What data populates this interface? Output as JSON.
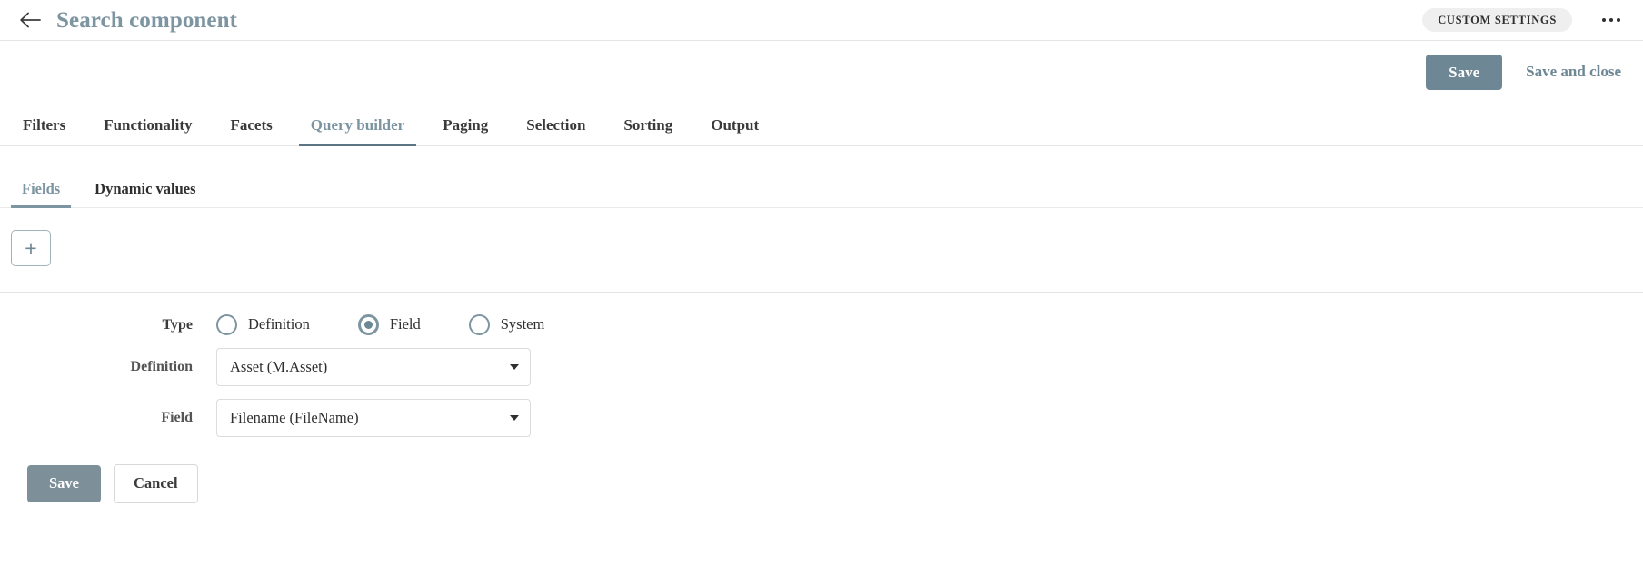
{
  "header": {
    "back_icon": "arrow-left-icon",
    "title": "Search component",
    "custom_settings_label": "CUSTOM SETTINGS",
    "overflow_icon": "ellipsis-icon"
  },
  "actions": {
    "save_label": "Save",
    "save_and_close_label": "Save and close"
  },
  "tabs": [
    {
      "label": "Filters",
      "active": false
    },
    {
      "label": "Functionality",
      "active": false
    },
    {
      "label": "Facets",
      "active": false
    },
    {
      "label": "Query builder",
      "active": true
    },
    {
      "label": "Paging",
      "active": false
    },
    {
      "label": "Selection",
      "active": false
    },
    {
      "label": "Sorting",
      "active": false
    },
    {
      "label": "Output",
      "active": false
    }
  ],
  "subtabs": [
    {
      "label": "Fields",
      "active": true
    },
    {
      "label": "Dynamic values",
      "active": false
    }
  ],
  "toolbar": {
    "add_label": "+"
  },
  "form": {
    "type": {
      "label": "Type",
      "options": [
        {
          "label": "Definition",
          "selected": false
        },
        {
          "label": "Field",
          "selected": true
        },
        {
          "label": "System",
          "selected": false
        }
      ]
    },
    "definition": {
      "label": "Definition",
      "value": "Asset (M.Asset)"
    },
    "field": {
      "label": "Field",
      "value": "Filename (FileName)"
    },
    "save_label": "Save",
    "cancel_label": "Cancel"
  },
  "colors": {
    "accent": "#6d8795",
    "title": "#7d94a1",
    "text": "#2f2f2f",
    "border": "#e4e4e4"
  }
}
